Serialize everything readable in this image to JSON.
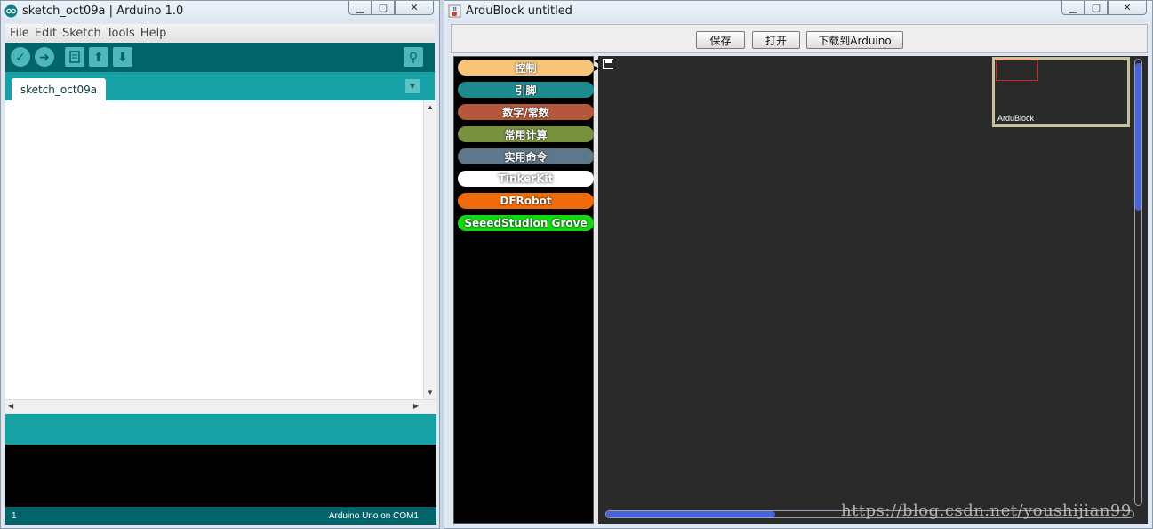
{
  "arduino": {
    "title": "sketch_oct09a | Arduino 1.0",
    "menu": [
      "File",
      "Edit",
      "Sketch",
      "Tools",
      "Help"
    ],
    "tab_name": "sketch_oct09a",
    "line_number": "1",
    "board_status": "Arduino Uno on COM1",
    "toolbar_icons": [
      "verify-icon",
      "upload-icon",
      "new-icon",
      "open-icon",
      "save-icon",
      "serial-monitor-icon"
    ],
    "colors": {
      "toolbar": "#006468",
      "tabstrip": "#17a1a5",
      "console": "#000000"
    }
  },
  "ardublock": {
    "title": "ArduBlock untitled",
    "buttons": {
      "save": "保存",
      "open": "打开",
      "upload": "下载到Arduino"
    },
    "categories": [
      {
        "label": "控制",
        "color": "#f6c57a"
      },
      {
        "label": "引脚",
        "color": "#1d8a8e"
      },
      {
        "label": "数字/常数",
        "color": "#b5573a"
      },
      {
        "label": "常用计算",
        "color": "#78913f"
      },
      {
        "label": "实用命令",
        "color": "#5d7888"
      },
      {
        "label": "TinkerKit",
        "color": "#ffffff"
      },
      {
        "label": "DFRobot",
        "color": "#f06a0a"
      },
      {
        "label": "SeeedStudion Grove",
        "color": "#15d615"
      }
    ],
    "minimap_label": "ArduBlock",
    "colors": {
      "canvas": "#2a2a2a",
      "scroll_thumb": "#4a64d8"
    }
  },
  "watermark": "https://blog.csdn.net/youshijian99"
}
